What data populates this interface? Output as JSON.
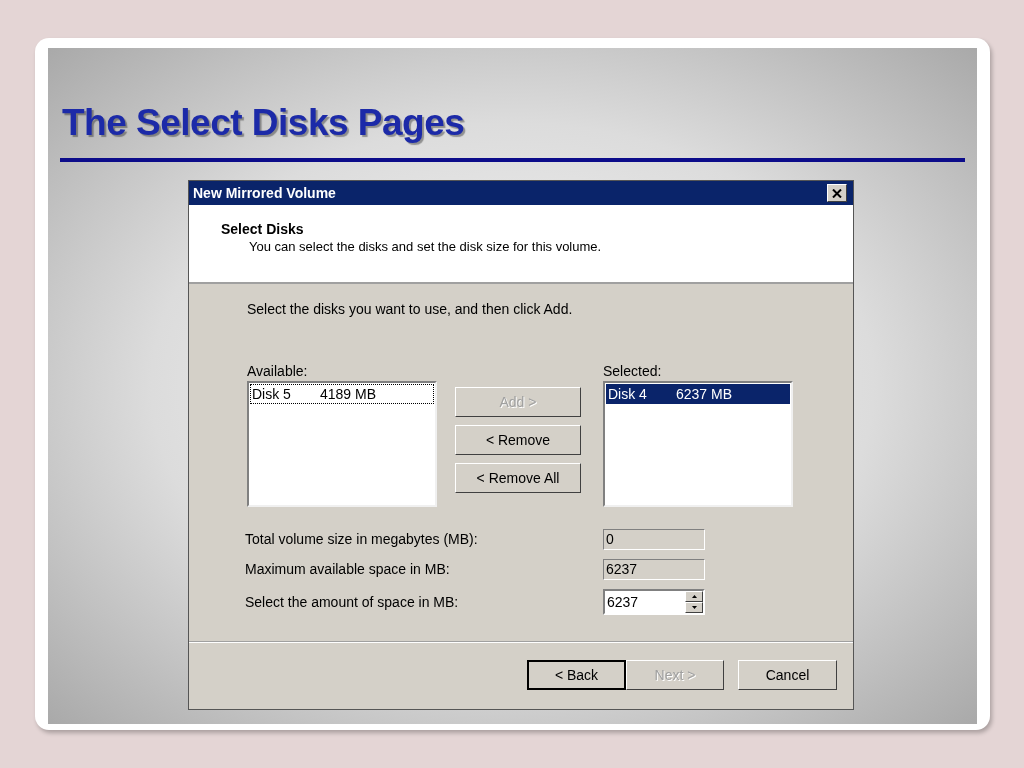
{
  "slide": {
    "title": "The Select Disks Pages"
  },
  "dialog": {
    "title": "New Mirrored Volume",
    "header": {
      "title": "Select Disks",
      "subtitle": "You can select the disks and set the disk size for this volume."
    },
    "instruction": "Select the disks you want to use, and then click Add.",
    "available": {
      "label": "Available:",
      "items": [
        {
          "name": "Disk 5",
          "size": "4189 MB",
          "selected": false,
          "focused": true
        }
      ]
    },
    "chosen": {
      "label": "Selected:",
      "items": [
        {
          "name": "Disk 4",
          "size": "6237 MB",
          "selected": true,
          "focused": false
        }
      ]
    },
    "move_buttons": [
      {
        "label": "Add >",
        "disabled": true
      },
      {
        "label": "< Remove",
        "disabled": false
      },
      {
        "label": "< Remove All",
        "disabled": false
      }
    ],
    "fields": [
      {
        "kind": "readonly",
        "label": "Total volume size in megabytes (MB):",
        "value": "0"
      },
      {
        "kind": "readonly",
        "label": "Maximum available space in MB:",
        "value": "6237"
      },
      {
        "kind": "spinner",
        "label": "Select the amount of space in MB:",
        "value": "6237"
      }
    ],
    "buttons": [
      {
        "label": "< Back",
        "disabled": false,
        "default": true
      },
      {
        "label": "Next >",
        "disabled": true,
        "default": false
      },
      {
        "label": "Cancel",
        "disabled": false,
        "default": false
      }
    ]
  }
}
